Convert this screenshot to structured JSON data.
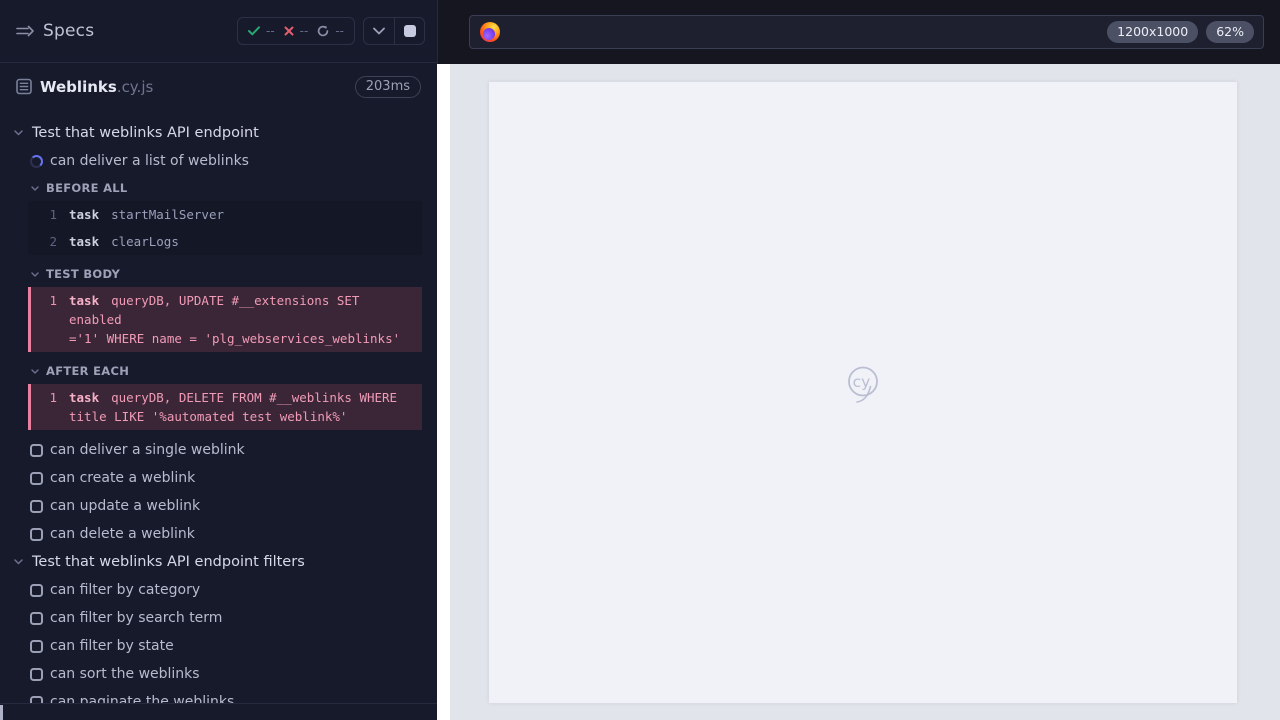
{
  "sidebar": {
    "title": "Specs",
    "stats": {
      "passed": "--",
      "failed": "--",
      "running": "--"
    },
    "spec": {
      "name": "Weblinks",
      "ext": ".cy.js",
      "duration": "203ms"
    },
    "tree": {
      "suite1_title": "Test that weblinks API endpoint",
      "running_test": "can deliver a list of weblinks",
      "hook_before_all": "BEFORE ALL",
      "hook_test_body": "TEST BODY",
      "hook_after_each": "AFTER EACH",
      "commands_before_all": [
        {
          "num": "1",
          "method": "task",
          "message": "startMailServer"
        },
        {
          "num": "2",
          "method": "task",
          "message": "clearLogs"
        }
      ],
      "commands_test_body": [
        {
          "num": "1",
          "method": "task",
          "message": "queryDB, UPDATE #__extensions SET enabled\n='1' WHERE name = 'plg_webservices_weblinks'"
        }
      ],
      "commands_after_each": [
        {
          "num": "1",
          "method": "task",
          "message": "queryDB, DELETE FROM #__weblinks WHERE\ntitle LIKE '%automated test weblink%'"
        }
      ],
      "suite1_pending": [
        "can deliver a single weblink",
        "can create a weblink",
        "can update a weblink",
        "can delete a weblink"
      ],
      "suite2_title": "Test that weblinks API endpoint filters",
      "suite2_pending": [
        "can filter by category",
        "can filter by search term",
        "can filter by state",
        "can sort the weblinks",
        "can paginate the weblinks"
      ]
    }
  },
  "header": {
    "browser": "firefox",
    "viewport_size": "1200x1000",
    "viewport_scale": "62%"
  },
  "aut": {
    "watermark": "cy"
  },
  "colors": {
    "accent_pink": "#e87f9f",
    "passed_green": "#29a873",
    "failed_red": "#e25f6d",
    "running_blue": "#6673f2"
  }
}
